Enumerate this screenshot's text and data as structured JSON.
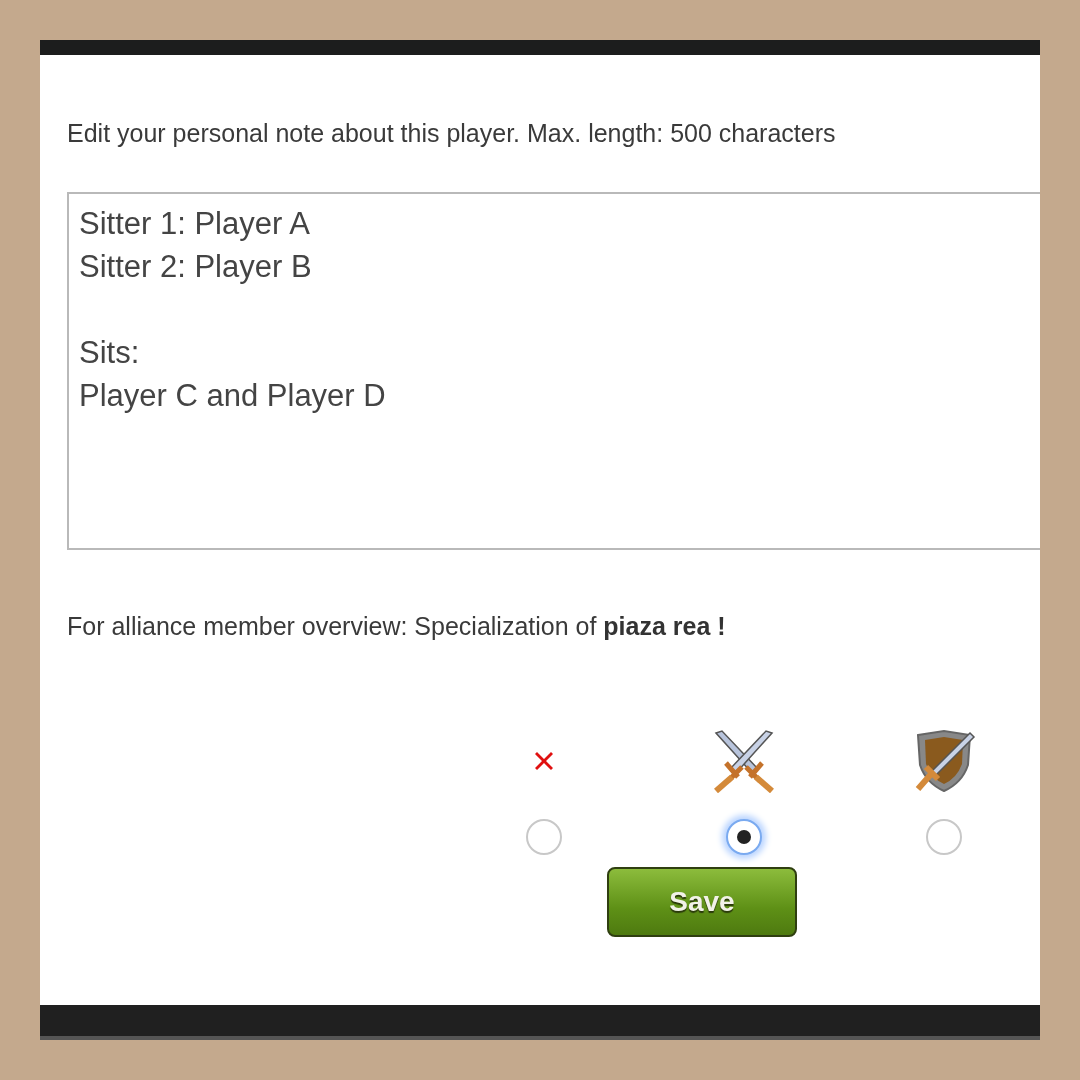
{
  "note_label": "Edit your personal note about this player. Max. length: 500 characters",
  "note": {
    "value": "Sitter 1: Player A\nSitter 2: Player B\n\nSits:\nPlayer C and Player D"
  },
  "specialization_label": "For alliance member overview: Specialization of **piaza rea !**",
  "options": [
    {
      "kind": "none",
      "selected": false
    },
    {
      "kind": "offensive",
      "selected": true
    },
    {
      "kind": "defensive",
      "selected": false
    }
  ],
  "buttons": [
    {
      "label": "Save"
    }
  ]
}
